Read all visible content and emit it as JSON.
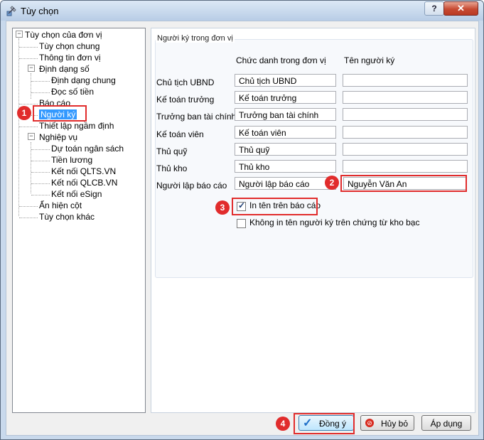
{
  "window": {
    "title": "Tùy chọn",
    "help_glyph": "?",
    "close_glyph": "✕"
  },
  "tree": {
    "root": "Tùy chọn của đơn vị",
    "items": [
      {
        "label": "Tùy chọn chung"
      },
      {
        "label": "Thông tin đơn vị"
      },
      {
        "label": "Định dạng số"
      },
      {
        "label": "Định dạng chung"
      },
      {
        "label": "Đọc số tiền"
      },
      {
        "label": "Báo cáo"
      },
      {
        "label": "Người ký",
        "selected": true
      },
      {
        "label": "Thiết lập ngầm định"
      },
      {
        "label": "Nghiệp vụ"
      },
      {
        "label": "Dự toán ngân sách"
      },
      {
        "label": "Tiền lương"
      },
      {
        "label": "Kết nối QLTS.VN"
      },
      {
        "label": "Kết nối QLCB.VN"
      },
      {
        "label": "Kết nối eSign"
      },
      {
        "label": "Ẩn hiện cột"
      },
      {
        "label": "Tùy chọn khác"
      }
    ]
  },
  "signers": {
    "group_title": "Người ký trong đơn vị",
    "col_title": "Chức danh trong đơn vị",
    "col_name": "Tên người ký",
    "rows": [
      {
        "label": "Chủ tịch UBND",
        "title": "Chủ tịch UBND",
        "name": ""
      },
      {
        "label": "Kế toán trưởng",
        "title": "Kế toán trưởng",
        "name": ""
      },
      {
        "label": "Trưởng ban tài chính",
        "title": "Trưởng ban tài chính",
        "name": ""
      },
      {
        "label": "Kế toán viên",
        "title": "Kế toán viên",
        "name": ""
      },
      {
        "label": "Thủ quỹ",
        "title": "Thủ quỹ",
        "name": ""
      },
      {
        "label": "Thủ kho",
        "title": "Thủ kho",
        "name": ""
      },
      {
        "label": "Người lập báo cáo",
        "title": "Người lập báo cáo",
        "name": "Nguyễn Văn An"
      }
    ],
    "print_on_report": {
      "label": "In tên trên báo cáo",
      "checked": true
    },
    "no_print_treasury": {
      "label": "Không in tên người ký trên chứng từ kho bạc",
      "checked": false
    }
  },
  "buttons": {
    "ok": "Đồng ý",
    "cancel": "Hủy bỏ",
    "apply": "Áp dụng"
  },
  "steps": [
    "1",
    "2",
    "3",
    "4"
  ],
  "colors": {
    "highlight": "#e12c2c",
    "selection": "#3399ff",
    "titlebar": "#c9d9ec"
  }
}
